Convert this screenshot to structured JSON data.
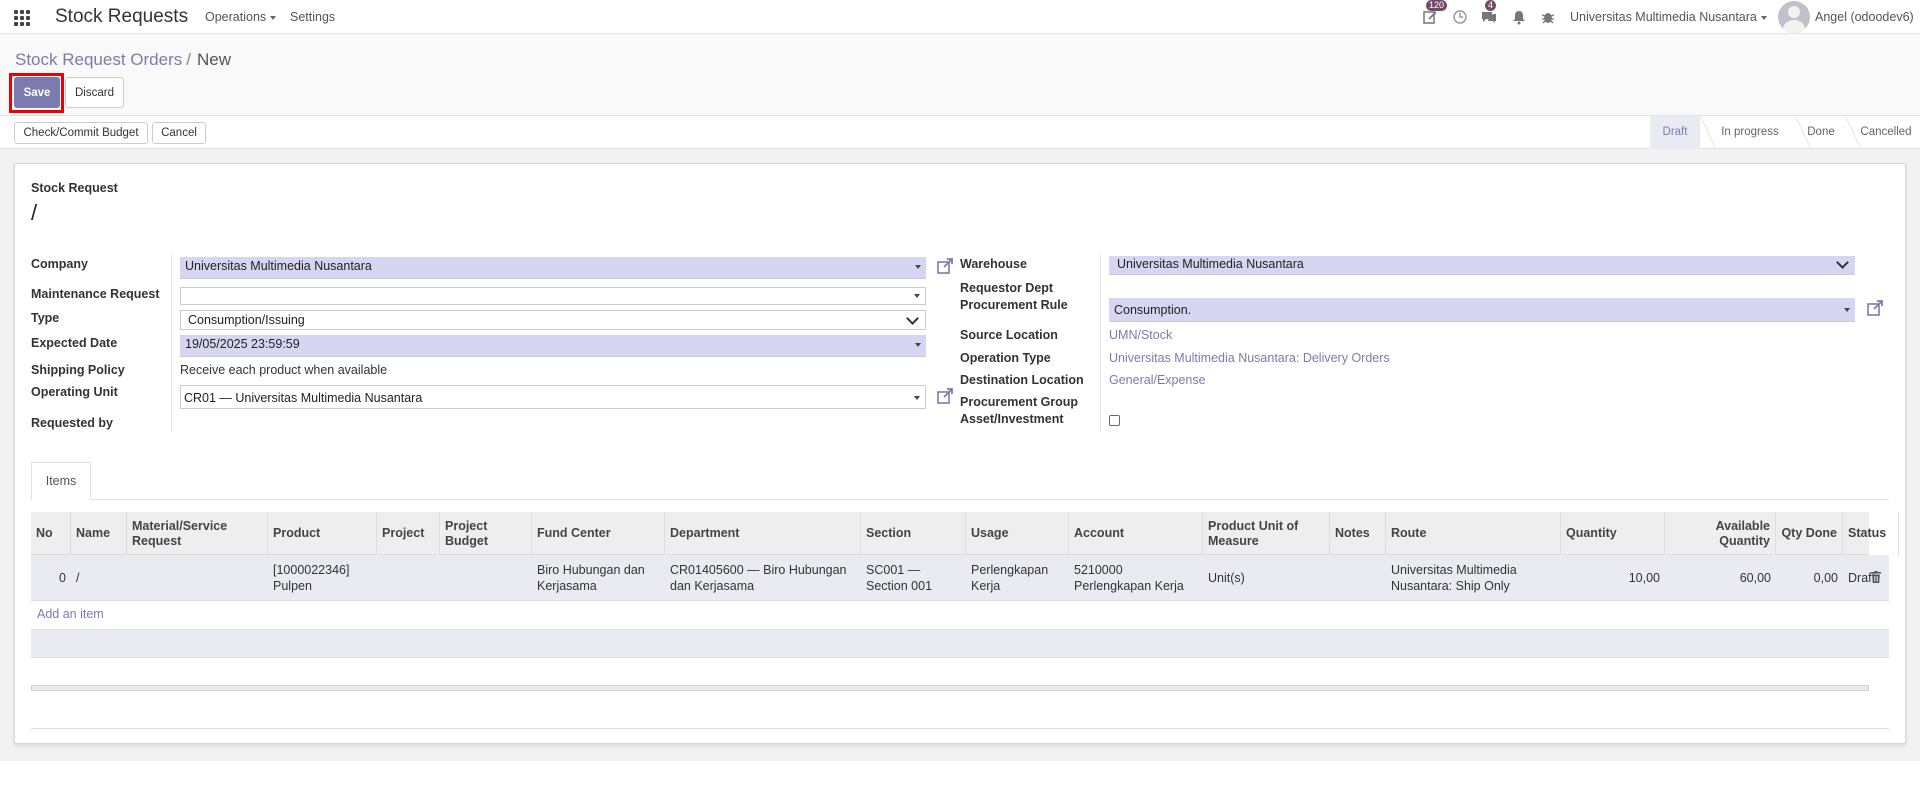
{
  "navbar": {
    "app_title": "Stock Requests",
    "menus": [
      {
        "label": "Operations"
      },
      {
        "label": "Settings"
      }
    ],
    "activity_badge": "120",
    "messages_badge": "4",
    "company": "Universitas Multimedia Nusantara",
    "user": "Angel (odoodev6)"
  },
  "breadcrumb": {
    "parent": "Stock Request Orders",
    "separator": "/",
    "current": "New"
  },
  "actions": {
    "save": "Save",
    "discard": "Discard"
  },
  "header_buttons": {
    "check_budget": "Check/Commit Budget",
    "cancel": "Cancel"
  },
  "stages": [
    "Draft",
    "In progress",
    "Done",
    "Cancelled"
  ],
  "active_stage": "Draft",
  "form": {
    "title_label": "Stock Request",
    "name": "/",
    "left": {
      "company": {
        "label": "Company",
        "value": "Universitas Multimedia Nusantara"
      },
      "maintenance_request": {
        "label": "Maintenance Request",
        "value": ""
      },
      "type": {
        "label": "Type",
        "value": "Consumption/Issuing"
      },
      "expected_date": {
        "label": "Expected Date",
        "value": "19/05/2025 23:59:59"
      },
      "shipping_policy": {
        "label": "Shipping Policy",
        "value": "Receive each product when available"
      },
      "operating_unit": {
        "label": "Operating Unit",
        "value": "CR01 — Universitas Multimedia Nusantara"
      },
      "requested_by": {
        "label": "Requested by",
        "value": ""
      }
    },
    "right": {
      "warehouse": {
        "label": "Warehouse",
        "value": "Universitas Multimedia Nusantara"
      },
      "requestor_dept": {
        "label": "Requestor Dept"
      },
      "procurement_rule": {
        "label": "Procurement Rule",
        "value": "Consumption."
      },
      "source_location": {
        "label": "Source Location",
        "value": "UMN/Stock"
      },
      "operation_type": {
        "label": "Operation Type",
        "value": "Universitas Multimedia Nusantara: Delivery Orders"
      },
      "destination_location": {
        "label": "Destination Location",
        "value": "General/Expense"
      },
      "procurement_group": {
        "label": "Procurement Group"
      },
      "asset_investment": {
        "label": "Asset/Investment",
        "checked": false
      }
    }
  },
  "notebook": {
    "tabs": [
      {
        "label": "Items",
        "active": true
      }
    ]
  },
  "items_table": {
    "columns": [
      "No",
      "Name",
      "Material/Service Request",
      "Product",
      "Project",
      "Project Budget",
      "Fund Center",
      "Department",
      "Section",
      "Usage",
      "Account",
      "Product Unit of Measure",
      "Notes",
      "Route",
      "Quantity",
      "Available Quantity",
      "Qty Done",
      "Status"
    ],
    "rows": [
      {
        "no": "0",
        "name": "/",
        "material_request": "",
        "product": "[1000022346] Pulpen",
        "project": "",
        "project_budget": "",
        "fund_center": "Biro Hubungan dan Kerjasama",
        "department": "CR01405600 — Biro Hubungan dan Kerjasama",
        "section": "SC001 — Section 001",
        "usage": "Perlengkapan Kerja",
        "account": "5210000 Perlengkapan Kerja",
        "uom": "Unit(s)",
        "notes": "",
        "route": "Universitas Multimedia Nusantara: Ship Only",
        "quantity": "10,00",
        "available_quantity": "60,00",
        "qty_done": "0,00",
        "status": "Draft"
      }
    ],
    "add_line": "Add an item"
  },
  "colors": {
    "accent": "#7c7bad",
    "required_field": "#d6d6f2",
    "highlight": "#e00000"
  }
}
